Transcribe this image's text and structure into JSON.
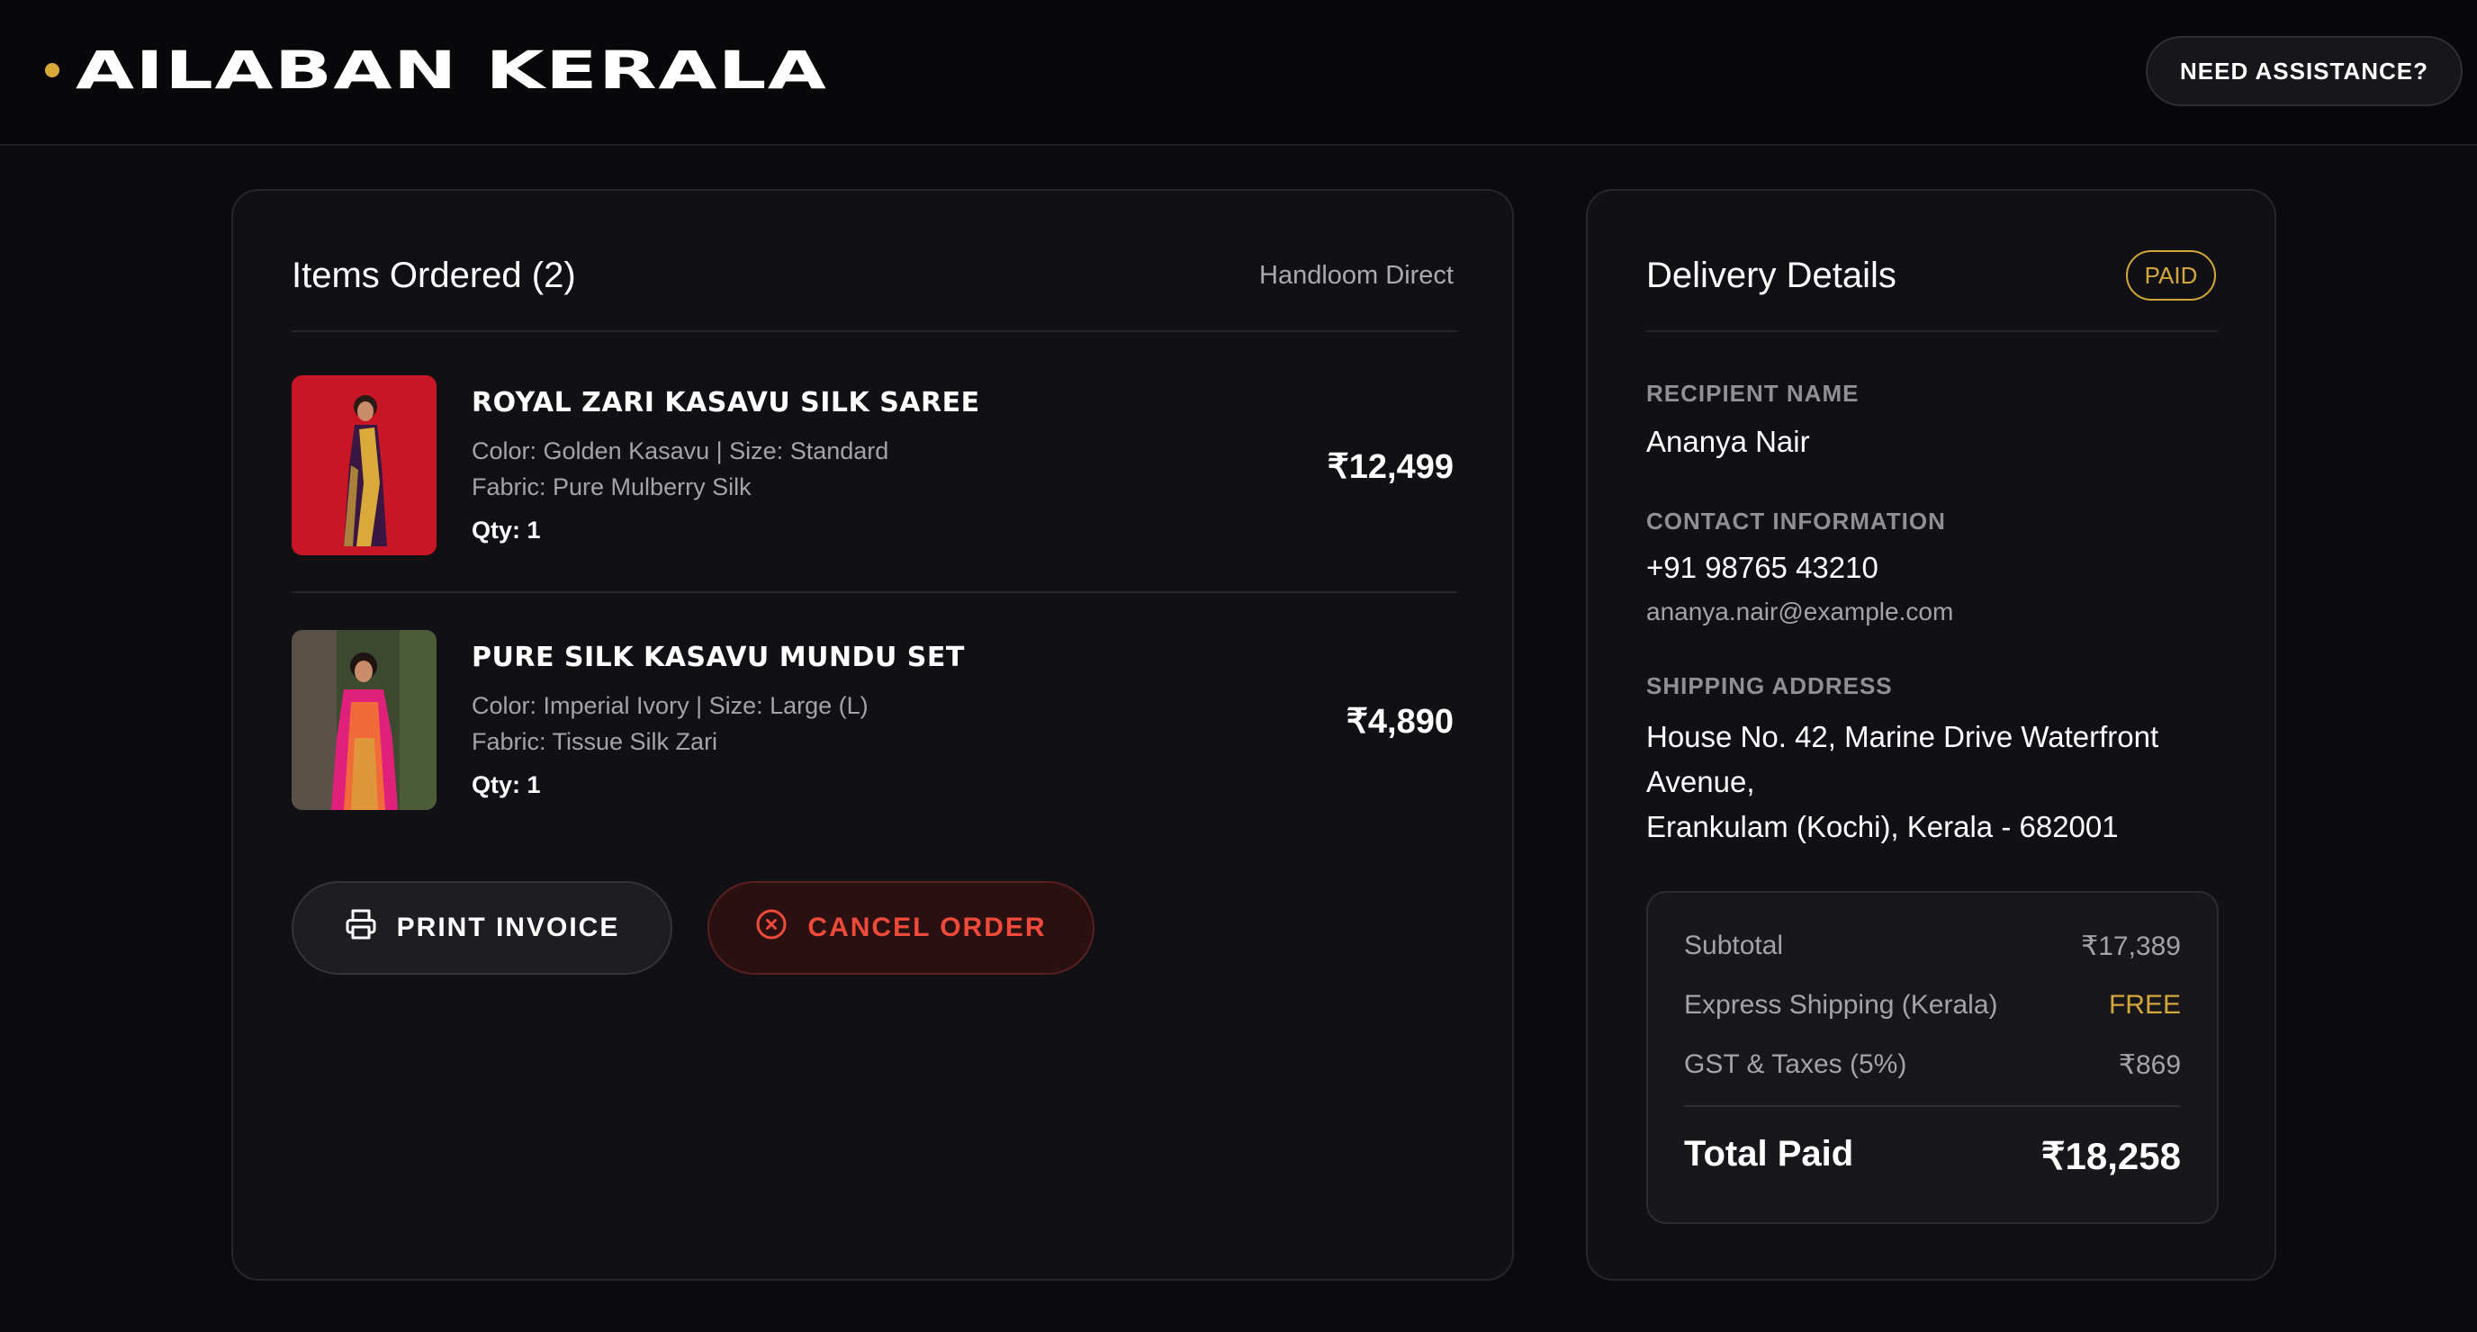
{
  "header": {
    "brand": "AILABAN KERALA",
    "assist_label": "NEED ASSISTANCE?",
    "accent": "#d9a93a"
  },
  "items_card": {
    "title": "Items Ordered (2)",
    "vendor": "Handloom Direct",
    "items": [
      {
        "name": "ROYAL ZARI KASAVU SILK SAREE",
        "meta1": "Color: Golden Kasavu | Size: Standard",
        "meta2": "Fabric: Pure Mulberry Silk",
        "qty": "Qty: 1",
        "price": "₹12,499"
      },
      {
        "name": "PURE SILK KASAVU MUNDU SET",
        "meta1": "Color: Imperial Ivory | Size: Large (L)",
        "meta2": "Fabric: Tissue Silk Zari",
        "qty": "Qty: 1",
        "price": "₹4,890"
      }
    ],
    "print_label": "PRINT INVOICE",
    "cancel_label": "CANCEL ORDER"
  },
  "delivery": {
    "title": "Delivery Details",
    "status": "PAID",
    "recipient_label": "RECIPIENT NAME",
    "recipient": "Ananya Nair",
    "contact_label": "CONTACT INFORMATION",
    "phone": "+91 98765 43210",
    "email": "ananya.nair@example.com",
    "shipping_label": "SHIPPING ADDRESS",
    "address_line1": "House No. 42, Marine Drive Waterfront Avenue,",
    "address_line2": "Erankulam (Kochi), Kerala - 682001",
    "summary": {
      "subtotal_label": "Subtotal",
      "subtotal": "₹17,389",
      "shipping_label": "Express Shipping (Kerala)",
      "shipping": "FREE",
      "tax_label": "GST & Taxes (5%)",
      "tax": "₹869",
      "total_label": "Total Paid",
      "total": "₹18,258"
    }
  },
  "colors": {
    "background": "#0b0b0e",
    "card": "#111115",
    "gold": "#d4a73a",
    "danger": "#ef4a3a"
  }
}
